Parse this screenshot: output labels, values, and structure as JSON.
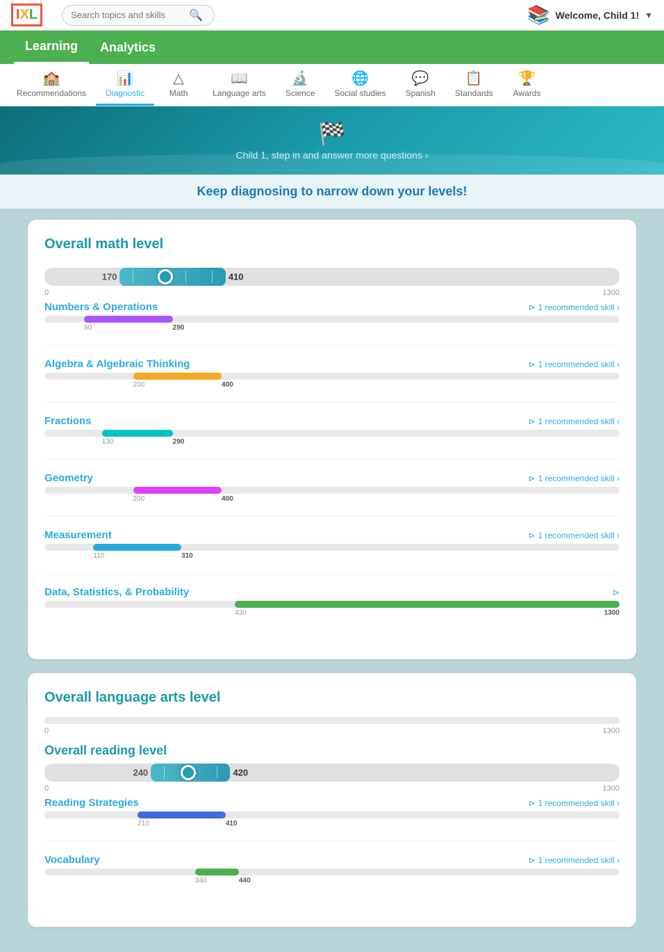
{
  "header": {
    "search_placeholder": "Search topics and skills",
    "welcome_text": "Welcome, Child 1!",
    "logo_text": "IXL"
  },
  "nav": {
    "items": [
      {
        "label": "Learning",
        "active": true
      },
      {
        "label": "Analytics",
        "active": false
      }
    ]
  },
  "tabs": [
    {
      "label": "Recommendations",
      "icon": "🏫",
      "active": false
    },
    {
      "label": "Diagnostic",
      "icon": "📊",
      "active": true
    },
    {
      "label": "Math",
      "icon": "△",
      "active": false
    },
    {
      "label": "Language arts",
      "icon": "📖",
      "active": false
    },
    {
      "label": "Science",
      "icon": "🔬",
      "active": false
    },
    {
      "label": "Social studies",
      "icon": "🌐",
      "active": false
    },
    {
      "label": "Spanish",
      "icon": "💬",
      "active": false
    },
    {
      "label": "Standards",
      "icon": "📋",
      "active": false
    },
    {
      "label": "Awards",
      "icon": "🏆",
      "active": false
    }
  ],
  "banner": {
    "text": "Child 1, step in and answer more questions ›"
  },
  "prompt": "Keep diagnosing to narrow down your levels!",
  "math_section": {
    "title": "Overall math level",
    "overall": {
      "low": 170,
      "high": 410,
      "min": 0,
      "max": 1300,
      "fill_color": "#4db8c8",
      "fill_pct_start": 13.1,
      "fill_pct_end": 31.5
    },
    "sublevels": [
      {
        "name": "Numbers & Operations",
        "color": "#a855f7",
        "low": 90,
        "high": 290,
        "min": 0,
        "max": 1300,
        "fill_pct_start": 6.9,
        "fill_pct_end": 22.3,
        "recommended": "1 recommended skill ›"
      },
      {
        "name": "Algebra & Algebraic Thinking",
        "color": "#f5a623",
        "low": 200,
        "high": 400,
        "min": 0,
        "max": 1300,
        "fill_pct_start": 15.4,
        "fill_pct_end": 30.8,
        "recommended": "1 recommended skill ›"
      },
      {
        "name": "Fractions",
        "color": "#00c4c4",
        "low": 130,
        "high": 290,
        "min": 0,
        "max": 1300,
        "fill_pct_start": 10.0,
        "fill_pct_end": 22.3,
        "recommended": "1 recommended skill ›"
      },
      {
        "name": "Geometry",
        "color": "#e040fb",
        "low": 200,
        "high": 400,
        "min": 0,
        "max": 1300,
        "fill_pct_start": 15.4,
        "fill_pct_end": 30.8,
        "recommended": "1 recommended skill ›"
      },
      {
        "name": "Measurement",
        "color": "#29abe2",
        "low": 110,
        "high": 310,
        "min": 0,
        "max": 1300,
        "fill_pct_start": 8.5,
        "fill_pct_end": 23.8,
        "recommended": "1 recommended skill ›"
      },
      {
        "name": "Data, Statistics, & Probability",
        "color": "#4caf50",
        "low": 430,
        "high": 1300,
        "min": 0,
        "max": 1300,
        "fill_pct_start": 33.1,
        "fill_pct_end": 100,
        "recommended": ""
      }
    ]
  },
  "language_arts_section": {
    "title": "Overall language arts level",
    "overall_bar": {
      "min": 0,
      "max": 1300
    },
    "reading_level": {
      "title": "Overall reading level",
      "low": 240,
      "high": 420,
      "min": 0,
      "max": 1300,
      "fill_pct_start": 18.5,
      "fill_pct_end": 32.3
    },
    "sublevels": [
      {
        "name": "Reading Strategies",
        "color": "#4169e1",
        "low": 210,
        "high": 410,
        "min": 0,
        "max": 1300,
        "fill_pct_start": 16.2,
        "fill_pct_end": 31.5,
        "recommended": "1 recommended skill ›"
      },
      {
        "name": "Vocabulary",
        "color": "#4caf50",
        "low": 340,
        "high": 440,
        "min": 0,
        "max": 1300,
        "fill_pct_start": 26.2,
        "fill_pct_end": 33.8,
        "recommended": "1 recommended skill ›"
      }
    ]
  }
}
